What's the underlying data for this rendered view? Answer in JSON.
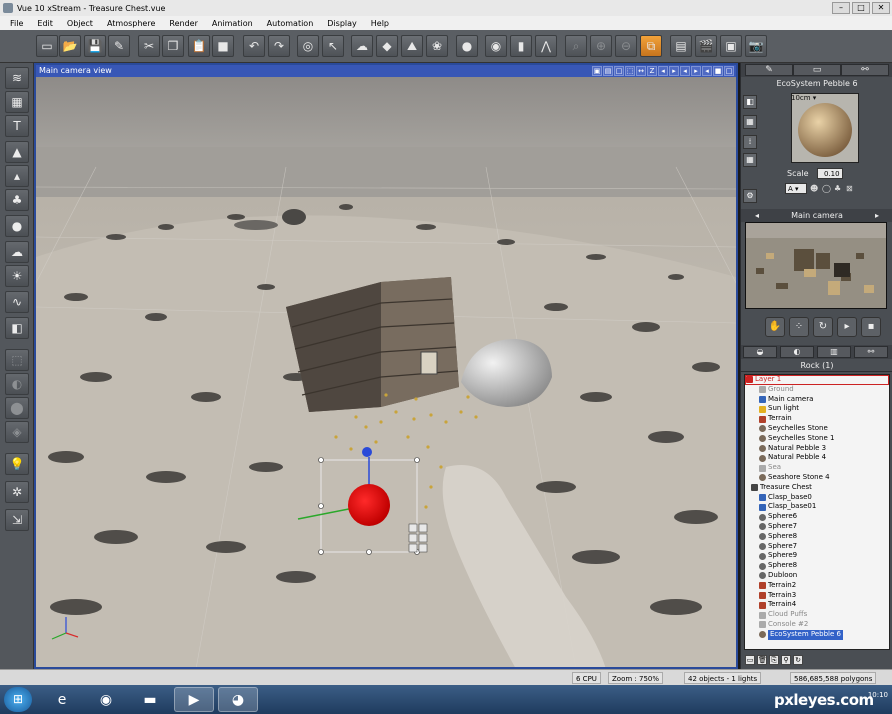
{
  "window": {
    "title": "Vue 10 xStream - Treasure Chest.vue",
    "controls": [
      "–",
      "□",
      "✕"
    ]
  },
  "menu": {
    "items": [
      "File",
      "Edit",
      "Object",
      "Atmosphere",
      "Render",
      "Animation",
      "Automation",
      "Display",
      "Help"
    ]
  },
  "toolbar": {
    "buttons": [
      {
        "name": "new-scene-icon",
        "glyph": "▭"
      },
      {
        "name": "open-icon",
        "glyph": "📂"
      },
      {
        "name": "save-icon",
        "glyph": "💾"
      },
      {
        "name": "save-as-icon",
        "glyph": "✎"
      },
      {
        "name": "cut-icon",
        "glyph": "✂"
      },
      {
        "name": "copy-icon",
        "glyph": "❐"
      },
      {
        "name": "paste-icon",
        "glyph": "📋"
      },
      {
        "name": "object-icon",
        "glyph": "■"
      },
      {
        "name": "undo-icon",
        "glyph": "↶"
      },
      {
        "name": "redo-icon",
        "glyph": "↷"
      },
      {
        "name": "select-icon",
        "glyph": "◎"
      },
      {
        "name": "pointer-icon",
        "glyph": "↖"
      },
      {
        "name": "atmosphere-icon",
        "glyph": "☁"
      },
      {
        "name": "cube-icon",
        "glyph": "◆"
      },
      {
        "name": "terrain-brush-icon",
        "glyph": "⛰"
      },
      {
        "name": "plant-icon",
        "glyph": "❀"
      },
      {
        "name": "materials-icon",
        "glyph": "●"
      },
      {
        "name": "render-icon",
        "glyph": "◉"
      },
      {
        "name": "stats-icon",
        "glyph": "▮"
      },
      {
        "name": "camera-angle-icon",
        "glyph": "⋀"
      },
      {
        "name": "zoom-fit-icon",
        "glyph": "⌕"
      },
      {
        "name": "zoom-in-icon",
        "glyph": "⊕"
      },
      {
        "name": "zoom-out-icon",
        "glyph": "⊖"
      },
      {
        "name": "render-area-icon",
        "glyph": "⧉"
      },
      {
        "name": "filmstrip-icon",
        "glyph": "▤"
      },
      {
        "name": "clapperboard-icon",
        "glyph": "🎬"
      },
      {
        "name": "display-frame-icon",
        "glyph": "▣"
      },
      {
        "name": "camera-icon",
        "glyph": "📷"
      }
    ]
  },
  "left_tools": [
    {
      "name": "water-plane-icon",
      "glyph": "≋"
    },
    {
      "name": "ground-plane-icon",
      "glyph": "▦"
    },
    {
      "name": "text-icon",
      "glyph": "T"
    },
    {
      "name": "terrain-icon",
      "glyph": "▲"
    },
    {
      "name": "symmetric-terrain-icon",
      "glyph": "▴"
    },
    {
      "name": "plant-tree-icon",
      "glyph": "♣"
    },
    {
      "name": "rock-icon",
      "glyph": "●"
    },
    {
      "name": "cloud-icon",
      "glyph": "☁"
    },
    {
      "name": "sun-icon",
      "glyph": "☀"
    },
    {
      "name": "curve-icon",
      "glyph": "∿"
    },
    {
      "name": "primitive-cube-icon",
      "glyph": "◧"
    },
    {
      "name": "group-icon",
      "glyph": "⬚"
    },
    {
      "name": "boolean-icon",
      "glyph": "◐"
    },
    {
      "name": "metablob-icon",
      "glyph": "⬤"
    },
    {
      "name": "smart-object-icon",
      "glyph": "◈"
    },
    {
      "name": "light-bulb-icon",
      "glyph": "💡"
    },
    {
      "name": "fan-icon",
      "glyph": "✲"
    },
    {
      "name": "export-icon",
      "glyph": "⇲"
    }
  ],
  "viewport": {
    "title": "Main camera view",
    "icons": [
      "▣",
      "▤",
      "□",
      "⬚",
      "↔",
      "Z",
      "◂",
      "▸",
      "◂",
      "▸",
      "◂",
      "■",
      "□"
    ]
  },
  "material": {
    "tabs": [
      "✎",
      "▭",
      "⚯"
    ],
    "name": "EcoSystem Pebble 6",
    "size_label": "10cm ▾",
    "scale_label": "Scale",
    "scale_value": "0.10",
    "mapping_value": "A ▾"
  },
  "camera_panel": {
    "title": "Main camera",
    "left_arrow": "◂",
    "right_arrow": "▸"
  },
  "world": {
    "tabs": [
      "◒",
      "◐",
      "▥",
      "⚯"
    ],
    "rock_header": "Rock (1)",
    "objects": [
      {
        "label": "Layer 1",
        "kind": "layer",
        "indent": 0
      },
      {
        "label": "Ground",
        "kind": "dimmed",
        "indent": 14
      },
      {
        "label": "Main camera",
        "kind": "camera",
        "indent": 14
      },
      {
        "label": "Sun light",
        "kind": "light",
        "indent": 14
      },
      {
        "label": "Terrain",
        "kind": "terrain",
        "indent": 14
      },
      {
        "label": "Seychelles Stone",
        "kind": "rock",
        "indent": 14
      },
      {
        "label": "Seychelles Stone 1",
        "kind": "rock",
        "indent": 14
      },
      {
        "label": "Natural Pebble 3",
        "kind": "rock",
        "indent": 14
      },
      {
        "label": "Natural Pebble 4",
        "kind": "rock",
        "indent": 14
      },
      {
        "label": "Sea",
        "kind": "dimmed",
        "indent": 14
      },
      {
        "label": "Seashore Stone 4",
        "kind": "rock",
        "indent": 14
      },
      {
        "label": "Treasure Chest",
        "kind": "group",
        "indent": 6
      },
      {
        "label": "Clasp_base0",
        "kind": "mesh",
        "indent": 14
      },
      {
        "label": "Clasp_base01",
        "kind": "mesh",
        "indent": 14
      },
      {
        "label": "Sphere6",
        "kind": "sphere",
        "indent": 14
      },
      {
        "label": "Sphere7",
        "kind": "sphere",
        "indent": 14
      },
      {
        "label": "Sphere8",
        "kind": "sphere",
        "indent": 14
      },
      {
        "label": "Sphere7",
        "kind": "sphere",
        "indent": 14
      },
      {
        "label": "Sphere9",
        "kind": "sphere",
        "indent": 14
      },
      {
        "label": "Sphere8",
        "kind": "sphere",
        "indent": 14
      },
      {
        "label": "Dubloon",
        "kind": "sphere",
        "indent": 14
      },
      {
        "label": "Terrain2",
        "kind": "terrain",
        "indent": 14
      },
      {
        "label": "Terrain3",
        "kind": "terrain",
        "indent": 14
      },
      {
        "label": "Terrain4",
        "kind": "terrain",
        "indent": 14
      },
      {
        "label": "Cloud Puffs",
        "kind": "dimmed",
        "indent": 14
      },
      {
        "label": "Console #2",
        "kind": "dimmed",
        "indent": 14
      },
      {
        "label": "EcoSystem Pebble 6",
        "kind": "selected",
        "indent": 14
      }
    ],
    "bottom_icons": [
      "▭",
      "🗑",
      "⎘",
      "⚲",
      "↻"
    ]
  },
  "status": {
    "cpu": "6 CPU",
    "zoom": "Zoom : 750%",
    "objects": "42 objects - 1 lights",
    "polygons": "586,685,588 polygons"
  },
  "taskbar": {
    "start": "⊞",
    "apps": [
      {
        "name": "internet-explorer-icon",
        "glyph": "e"
      },
      {
        "name": "chrome-icon",
        "glyph": "◉"
      },
      {
        "name": "file-explorer-icon",
        "glyph": "▬"
      },
      {
        "name": "media-player-icon",
        "glyph": "▶"
      },
      {
        "name": "vue-app-icon",
        "glyph": "◕"
      }
    ],
    "clock": "10:10",
    "brand": "pxleyes.com"
  }
}
